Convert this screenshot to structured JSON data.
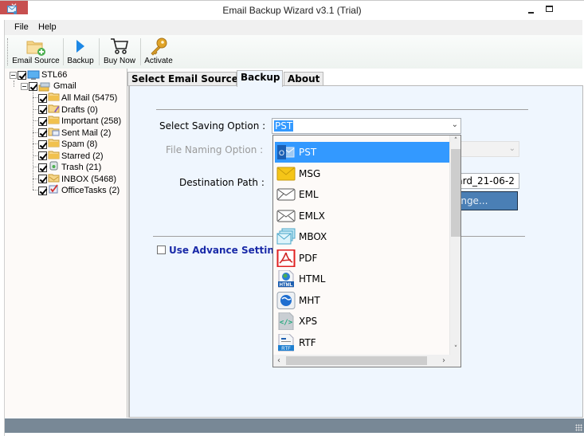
{
  "window": {
    "title": "Email Backup Wizard v3.1 (Trial)",
    "close_glyph": "✕",
    "minimize_glyph": "—",
    "maximize_glyph": "☐"
  },
  "menu": {
    "items": [
      {
        "label": "File"
      },
      {
        "label": "Help"
      }
    ]
  },
  "toolbar": {
    "items": [
      {
        "label": "Email Source",
        "icon": "folder-add-icon"
      },
      {
        "label": "Backup",
        "icon": "play-icon"
      },
      {
        "label": "Buy Now",
        "icon": "cart-icon"
      },
      {
        "label": "Activate",
        "icon": "key-icon"
      }
    ]
  },
  "tree": {
    "root": {
      "label": "STL66",
      "checked": true
    },
    "account": {
      "label": "Gmail",
      "checked": true
    },
    "folders": [
      {
        "label": "All Mail (5475)",
        "checked": true,
        "icon": "folder-icon"
      },
      {
        "label": "Drafts (0)",
        "checked": true,
        "icon": "drafts-icon"
      },
      {
        "label": "Important (258)",
        "checked": true,
        "icon": "folder-icon"
      },
      {
        "label": "Sent Mail (2)",
        "checked": true,
        "icon": "sent-icon"
      },
      {
        "label": "Spam (8)",
        "checked": true,
        "icon": "folder-icon"
      },
      {
        "label": "Starred (2)",
        "checked": true,
        "icon": "folder-icon"
      },
      {
        "label": "Trash (21)",
        "checked": true,
        "icon": "trash-icon"
      },
      {
        "label": "INBOX (5468)",
        "checked": true,
        "icon": "inbox-icon"
      },
      {
        "label": "OfficeTasks (2)",
        "checked": true,
        "icon": "tasks-icon"
      }
    ]
  },
  "tabs": [
    {
      "label": "Select Email Source",
      "active": false
    },
    {
      "label": "Backup",
      "active": true
    },
    {
      "label": "About",
      "active": false
    }
  ],
  "backup": {
    "saving_option_label": "Select Saving Option :",
    "saving_option_value": "PST",
    "file_naming_label": "File Naming Option :",
    "destination_label": "Destination Path :",
    "destination_value": "zard_21-06-2",
    "change_button": "Change...",
    "advance_settings_label": "Use Advance Settings",
    "advance_settings_checked": false
  },
  "dropdown": {
    "options": [
      {
        "label": "PST",
        "icon": "outlook-pst-icon",
        "selected": true
      },
      {
        "label": "MSG",
        "icon": "envelope-msg-icon",
        "selected": false
      },
      {
        "label": "EML",
        "icon": "envelope-eml-icon",
        "selected": false
      },
      {
        "label": "EMLX",
        "icon": "envelope-emlx-icon",
        "selected": false
      },
      {
        "label": "MBOX",
        "icon": "mbox-icon",
        "selected": false
      },
      {
        "label": "PDF",
        "icon": "pdf-icon",
        "selected": false
      },
      {
        "label": "HTML",
        "icon": "html-icon",
        "selected": false
      },
      {
        "label": "MHT",
        "icon": "mht-icon",
        "selected": false
      },
      {
        "label": "XPS",
        "icon": "xps-icon",
        "selected": false
      },
      {
        "label": "RTF",
        "icon": "rtf-icon",
        "selected": false
      }
    ]
  }
}
